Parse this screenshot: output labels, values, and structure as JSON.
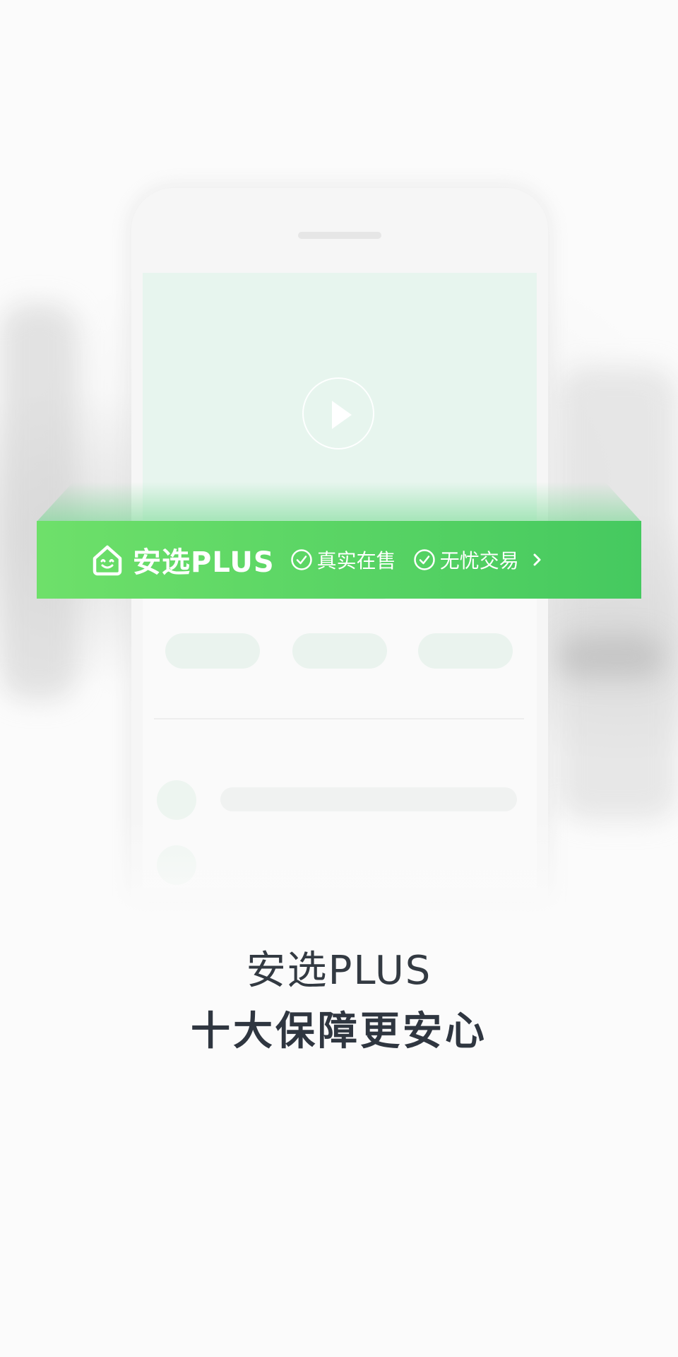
{
  "banner": {
    "brand_label": "安选PLUS",
    "features": [
      {
        "label": "真实在售",
        "icon": "check-circle-icon"
      },
      {
        "label": "无忧交易",
        "icon": "check-circle-icon"
      }
    ],
    "more_icon": "chevron-right-icon",
    "brand_icon": "house-smile-icon",
    "colors": {
      "start": "#6ee06a",
      "end": "#45c95f"
    }
  },
  "mockup": {
    "play_icon": "play-icon"
  },
  "headline": {
    "title": "安选PLUS",
    "subtitle": "十大保障更安心"
  }
}
